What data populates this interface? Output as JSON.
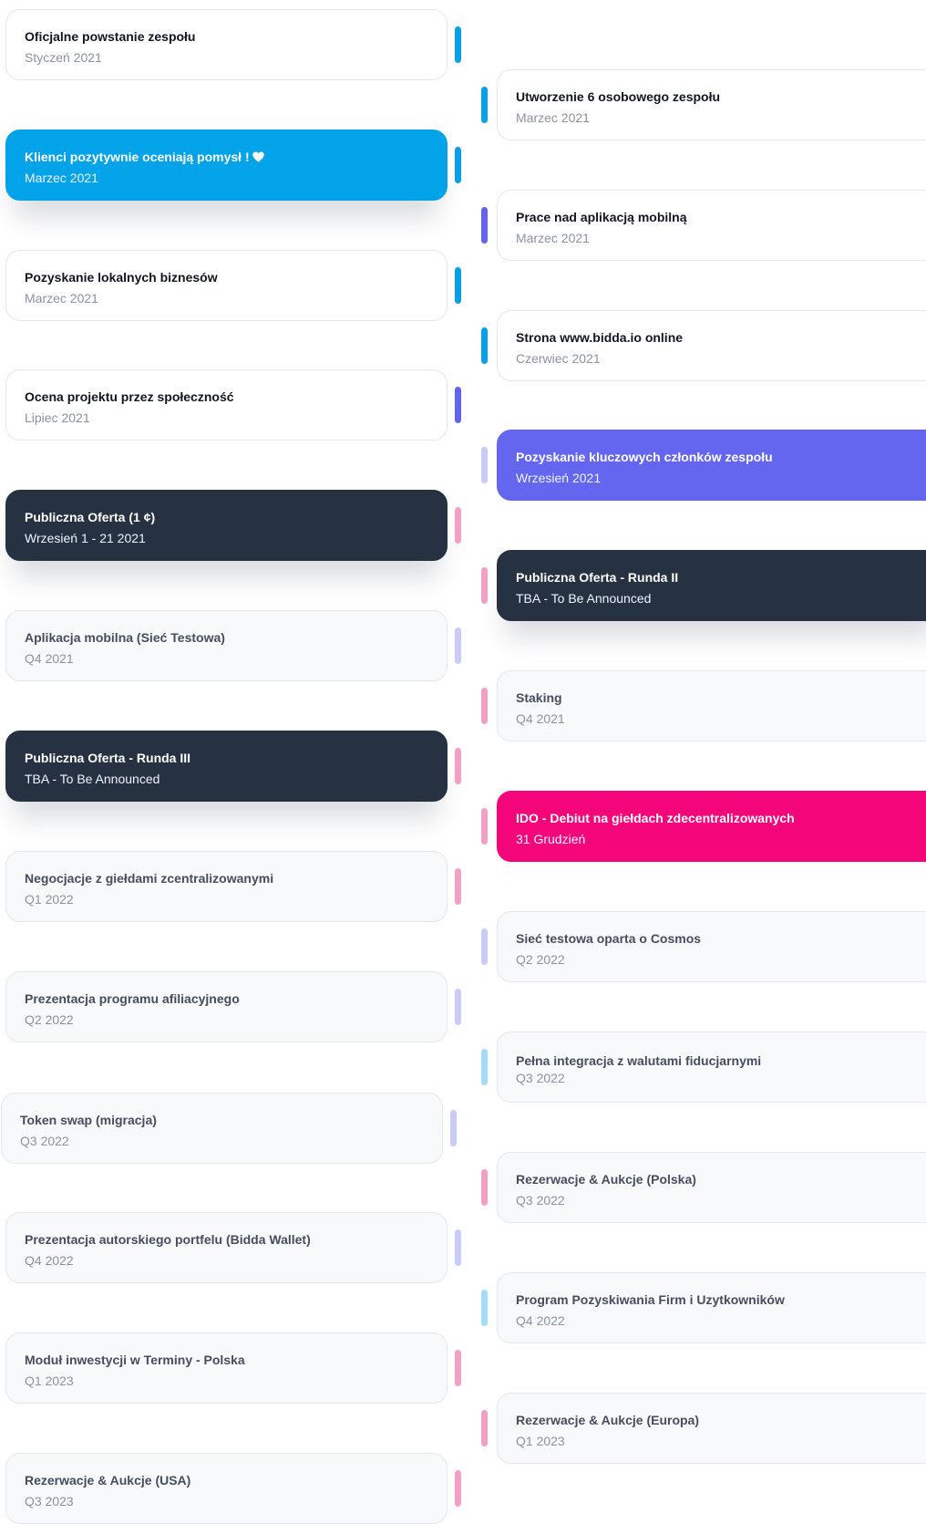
{
  "left": [
    {
      "title": "Oficjalne powstanie zespołu",
      "date": "Styczeń 2021"
    },
    {
      "title": "Klienci pozytywnie oceniają pomysł !",
      "date": "Marzec 2021",
      "icon": "heart-icon"
    },
    {
      "title": "Pozyskanie lokalnych biznesów",
      "date": "Marzec 2021"
    },
    {
      "title": "Ocena projektu przez społeczność",
      "date": "Lipiec 2021"
    },
    {
      "title": "Publiczna Oferta  (1 ¢)",
      "date": "Wrzesień 1 - 21  2021"
    },
    {
      "title": "Aplikacja mobilna (Sieć Testowa)",
      "date": "Q4 2021"
    },
    {
      "title": " Publiczna Oferta - Runda III",
      "date": "TBA - To Be Announced"
    },
    {
      "title": "Negocjacje z giełdami zcentralizowanymi",
      "date": "Q1 2022"
    },
    {
      "title": "Prezentacja programu afiliacyjnego",
      "date": "Q2 2022"
    },
    {
      "title": "Token swap (migracja)",
      "date": "Q3 2022"
    },
    {
      "title": "Prezentacja autorskiego portfelu (Bidda Wallet)",
      "date": "Q4 2022"
    },
    {
      "title": "Moduł inwestycji w Terminy - Polska",
      "date": "Q1 2023"
    },
    {
      "title": "Rezerwacje  & Aukcje (USA)",
      "date": "Q3 2023"
    }
  ],
  "right": [
    {
      "title": "Utworzenie 6 osobowego zespołu",
      "date": "Marzec 2021"
    },
    {
      "title": "Prace nad aplikacją mobilną",
      "date": "Marzec 2021"
    },
    {
      "title": "Strona www.bidda.io online",
      "date": "Czerwiec 2021"
    },
    {
      "title": "Pozyskanie kluczowych członków zespołu",
      "date": "Wrzesień  2021"
    },
    {
      "title": "Publiczna Oferta - Runda II",
      "date": "TBA - To Be Announced"
    },
    {
      "title": "Staking",
      "date": "Q4 2021"
    },
    {
      "title": "IDO - Debiut na giełdach zdecentralizowanych",
      "date": "31 Grudzień"
    },
    {
      "title": "Sieć testowa oparta o Cosmos",
      "date": "Q2 2022"
    },
    {
      "title": "Pełna integracja z walutami fiducjarnymi",
      "date": "Q3 2022"
    },
    {
      "title": "Rezerwacje & Aukcje (Polska)",
      "date": "Q3 2022"
    },
    {
      "title": " Program Pozyskiwania Firm i Uzytkowników",
      "date": "Q4 2022"
    },
    {
      "title": "Rezerwacje  & Aukcje (Europa)",
      "date": "Q1 2023"
    }
  ],
  "colors": {
    "blue": "#03a3e9",
    "purple": "#6466f0",
    "dark": "#263241",
    "pink": "#f5057a",
    "bar_pink": "#f3a0c4",
    "bar_lavender": "#c9cbf8",
    "bar_light_blue": "#a4dcf6"
  }
}
